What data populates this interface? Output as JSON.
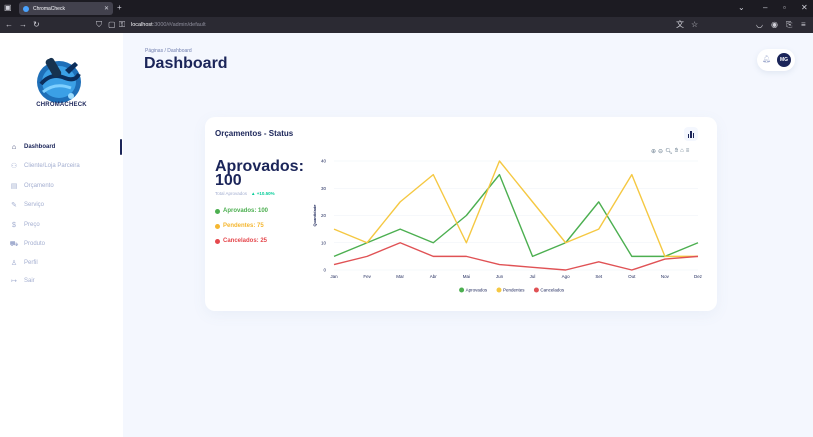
{
  "browser": {
    "tab_title": "ChromaCheck",
    "url_host": "localhost",
    "url_path": ":3000/#/admin/default"
  },
  "sidebar": {
    "brand": "CHROMACHECK",
    "items": [
      {
        "label": "Dashboard",
        "icon": "home-icon",
        "glyph": "⌂",
        "active": true
      },
      {
        "label": "Cliente/Loja Parceira",
        "icon": "users-icon",
        "glyph": "👥",
        "active": false
      },
      {
        "label": "Orçamento",
        "icon": "document-icon",
        "glyph": "▤",
        "active": false
      },
      {
        "label": "Serviço",
        "icon": "wrench-icon",
        "glyph": "✎",
        "active": false
      },
      {
        "label": "Preço",
        "icon": "dollar-icon",
        "glyph": "$",
        "active": false
      },
      {
        "label": "Produto",
        "icon": "cart-icon",
        "glyph": "🛒",
        "active": false
      },
      {
        "label": "Perfil",
        "icon": "person-icon",
        "glyph": "👤",
        "active": false
      },
      {
        "label": "Sair",
        "icon": "logout-icon",
        "glyph": "↦",
        "active": false
      }
    ]
  },
  "header": {
    "breadcrumb": "Páginas / Dashboard",
    "title": "Dashboard",
    "avatar_initials": "MG"
  },
  "card": {
    "title": "Orçamentos - Status",
    "big_label": "Aprovados: 100",
    "total_label": "Total Aprovados",
    "total_change": "+10.50%",
    "stats": [
      {
        "label": "Aprovados: 100",
        "color": "#4caf50"
      },
      {
        "label": "Pendentes: 75",
        "color": "#f5b731"
      },
      {
        "label": "Cancelados: 25",
        "color": "#e5484d"
      }
    ]
  },
  "chart_data": {
    "type": "line",
    "categories": [
      "Jan",
      "Fev",
      "Mar",
      "Abr",
      "Mai",
      "Jun",
      "Jul",
      "Ago",
      "Set",
      "Out",
      "Nov",
      "Dez"
    ],
    "ylabel": "Quantidade",
    "ylim": [
      0,
      40
    ],
    "yticks": [
      0,
      10,
      20,
      30,
      40
    ],
    "series": [
      {
        "name": "Aprovados",
        "color": "#4caf50",
        "values": [
          5,
          10,
          15,
          10,
          20,
          35,
          5,
          10,
          25,
          5,
          5,
          10
        ]
      },
      {
        "name": "Pendentes",
        "color": "#f5c842",
        "values": [
          15,
          10,
          25,
          35,
          10,
          40,
          25,
          10,
          15,
          35,
          5,
          5
        ]
      },
      {
        "name": "Cancelados",
        "color": "#e05255",
        "values": [
          2,
          5,
          10,
          5,
          5,
          2,
          1,
          0,
          3,
          0,
          4,
          5
        ]
      }
    ],
    "legend_position": "bottom"
  }
}
